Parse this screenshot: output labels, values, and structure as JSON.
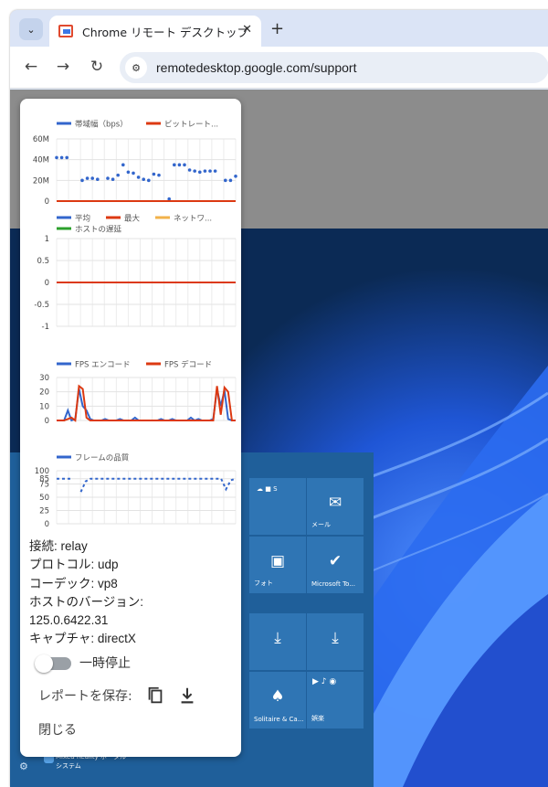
{
  "browser": {
    "tab_title": "Chrome リモート デスクトップ",
    "url": "remotedesktop.google.com/support",
    "new_tab": "+",
    "close_tab": "✕"
  },
  "panel": {
    "charts": [
      {
        "legend": [
          {
            "name": "帯域幅（bps）",
            "color": "#3366cc"
          },
          {
            "name": "ビットレート...",
            "color": "#dc3912"
          }
        ],
        "chart_data": {
          "type": "line",
          "yticks": [
            "60M",
            "40M",
            "20M",
            "0"
          ],
          "ylim": [
            0,
            60
          ],
          "series": [
            {
              "name": "帯域幅（bps）",
              "style": "dots",
              "values": [
                42,
                42,
                42,
                null,
                null,
                20,
                22,
                22,
                21,
                null,
                22,
                21,
                25,
                35,
                28,
                27,
                23,
                21,
                20,
                26,
                25,
                null,
                2,
                35,
                35,
                35,
                30,
                29,
                28,
                29,
                29,
                29,
                null,
                20,
                20,
                24
              ]
            },
            {
              "name": "ビットレート...",
              "values": [
                0,
                0,
                0,
                0,
                0,
                0,
                0,
                0,
                0,
                0,
                0,
                0,
                0,
                0,
                0,
                0,
                0,
                0,
                0,
                0,
                0,
                0,
                0,
                0,
                0,
                0,
                0,
                0,
                0,
                0,
                0,
                0,
                0,
                0,
                0,
                0
              ]
            }
          ]
        }
      },
      {
        "legend": [
          {
            "name": "平均",
            "color": "#3366cc"
          },
          {
            "name": "最大",
            "color": "#dc3912"
          },
          {
            "name": "ネットワ...",
            "color": "#f2b24a"
          },
          {
            "name": "ホストの遅延",
            "color": "#2ca02c"
          }
        ],
        "chart_data": {
          "type": "line",
          "yticks": [
            "1",
            "0.5",
            "0",
            "-0.5",
            "-1"
          ],
          "ylim": [
            -1,
            1
          ],
          "series": [
            {
              "name": "最大",
              "values": [
                0,
                0
              ]
            }
          ]
        }
      },
      {
        "legend": [
          {
            "name": "FPS エンコード",
            "color": "#3366cc"
          },
          {
            "name": "FPS デコード",
            "color": "#dc3912"
          }
        ],
        "chart_data": {
          "type": "line",
          "yticks": [
            "30",
            "20",
            "10",
            "0"
          ],
          "ylim": [
            0,
            30
          ],
          "series": [
            {
              "name": "FPS エンコード",
              "values": [
                0,
                0,
                0,
                7,
                0,
                1,
                22,
                10,
                7,
                1,
                0,
                0,
                0,
                1,
                0,
                0,
                0,
                1,
                0,
                0,
                0,
                2,
                0,
                0,
                0,
                0,
                0,
                0,
                1,
                0,
                0,
                1,
                0,
                0,
                0,
                0,
                2,
                0,
                1,
                0,
                0,
                0,
                1,
                22,
                10,
                21,
                1,
                0,
                0
              ]
            },
            {
              "name": "FPS デコード",
              "values": [
                0,
                0,
                0,
                1,
                2,
                0,
                24,
                22,
                2,
                0,
                0,
                0,
                0,
                0,
                0,
                0,
                0,
                0,
                0,
                0,
                0,
                0,
                0,
                0,
                0,
                0,
                0,
                0,
                0,
                0,
                0,
                0,
                0,
                0,
                0,
                0,
                0,
                0,
                0,
                0,
                0,
                0,
                0,
                24,
                4,
                23,
                20,
                0,
                0
              ]
            }
          ]
        }
      },
      {
        "legend": [
          {
            "name": "フレームの品質",
            "color": "#3366cc"
          }
        ],
        "chart_data": {
          "type": "line",
          "yticks": [
            "100",
            "85",
            "75",
            "50",
            "25",
            "0"
          ],
          "ylim": [
            0,
            100
          ],
          "series": [
            {
              "name": "フレームの品質",
              "style": "dashed",
              "values": [
                85,
                85,
                85,
                85,
                null,
                60,
                80,
                85,
                85,
                85,
                85,
                85,
                85,
                85,
                85,
                85,
                85,
                85,
                85,
                85,
                85,
                85,
                85,
                85,
                85,
                85,
                85,
                85,
                85,
                85,
                85,
                85,
                85,
                85,
                85,
                65,
                82,
                85
              ]
            }
          ]
        }
      }
    ],
    "info": [
      "接続: relay",
      "プロトコル: udp",
      "コーデック: vp8",
      "ホストのバージョン:",
      "125.0.6422.31",
      "キャプチャ: directX"
    ],
    "toggle_label": "一時停止",
    "report_label": "レポートを保存:",
    "close_label": "閉じる"
  },
  "desktop": {
    "tiles": [
      {
        "label": "メール",
        "icon": "mail-icon"
      },
      {
        "label": "フォト",
        "icon": "photos-icon"
      },
      {
        "label": "Microsoft To...",
        "icon": "todo-icon"
      },
      {
        "label": "Solitaire & Ca...",
        "icon": "cards-icon"
      },
      {
        "label": "娯楽",
        "icon": "entertainment-icon"
      }
    ],
    "mixed_reality_title": "Mixed Reality ポータル",
    "mixed_reality_subtitle": "システム"
  }
}
